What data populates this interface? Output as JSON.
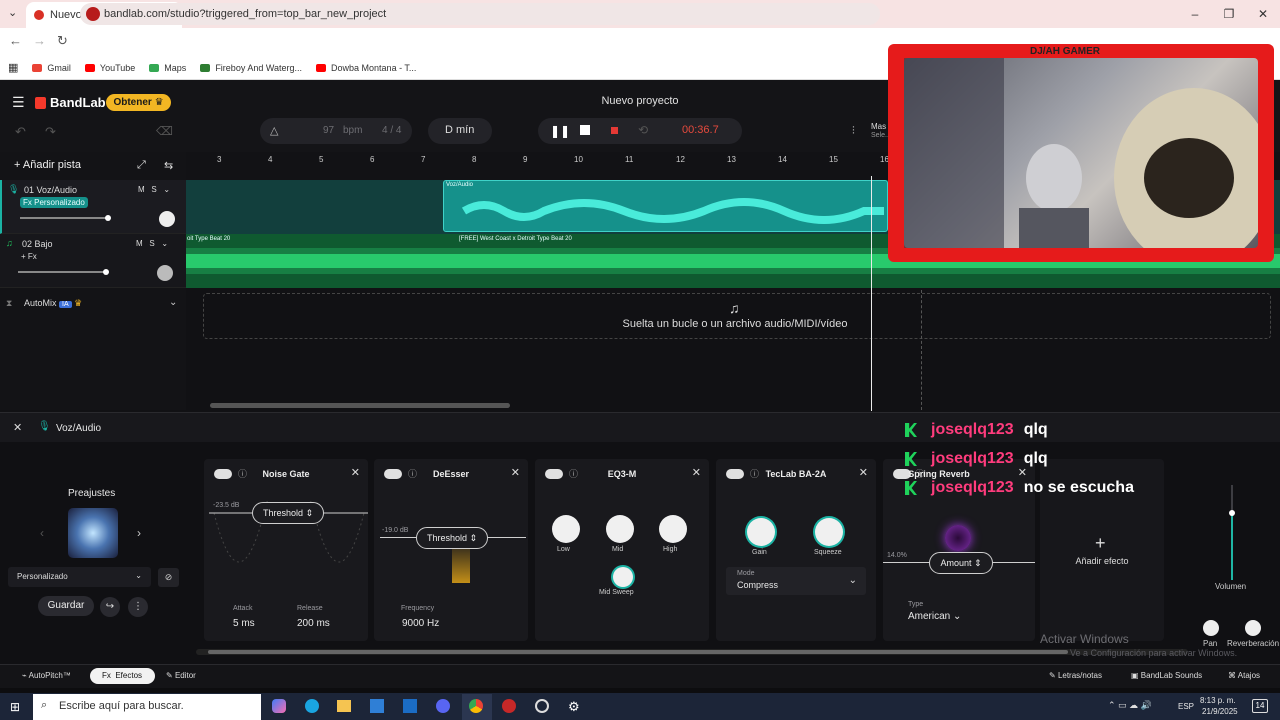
{
  "browser": {
    "tab_title": "Nuevo proyecto - Studio",
    "url": "bandlab.com/studio?triggered_from=top_bar_new_project",
    "bookmarks": [
      "Gmail",
      "YouTube",
      "Maps",
      "Fireboy And Waterg...",
      "Dowba Montana - T..."
    ]
  },
  "app": {
    "logo": "BandLab",
    "upgrade_label": "Obtener",
    "project_title": "Nuevo proyecto",
    "bpm_value": "97",
    "bpm_unit": "bpm",
    "time_signature": "4 / 4",
    "key": "D mín",
    "time": "00:36.7",
    "master_partial": "Mas",
    "master_partial2": "Sele..."
  },
  "tracks": {
    "add_label": "Añadir pista",
    "items": [
      {
        "name": "01  Voz/Audio",
        "fx": "Fx Personalizado",
        "clip": "Voz/Audio"
      },
      {
        "name": "02  Bajo",
        "fx": "+ Fx",
        "clip": "[FREE] West Coast x Detroit Type Beat 20",
        "clip_partial": "oit Type Beat 20"
      }
    ],
    "automix": "AutoMix",
    "automix_badge": "IA",
    "drop_text": "Suelta un bucle o un archivo audio/MIDI/vídeo",
    "ruler": [
      "3",
      "4",
      "5",
      "6",
      "7",
      "8",
      "9",
      "10",
      "11",
      "12",
      "13",
      "14",
      "15",
      "16"
    ]
  },
  "fx_panel": {
    "track_name": "Voz/Audio",
    "presets_title": "Preajustes",
    "preset_selected": "Personalizado",
    "save_label": "Guardar",
    "noise_gate": {
      "title": "Noise Gate",
      "db": "-23.5 dB",
      "threshold": "Threshold",
      "attack_label": "Attack",
      "attack": "5 ms",
      "release_label": "Release",
      "release": "200 ms"
    },
    "desser": {
      "title": "DeEsser",
      "db": "-19.0 dB",
      "threshold": "Threshold",
      "freq_label": "Frequency",
      "freq": "9000 Hz"
    },
    "eq": {
      "title": "EQ3-M",
      "low": "Low",
      "mid": "Mid",
      "high": "High",
      "sweep": "Mid Sweep"
    },
    "teclab": {
      "title": "TecLab BA-2A",
      "gain": "Gain",
      "squeeze": "Squeeze",
      "mode_label": "Mode",
      "mode": "Compress"
    },
    "spring": {
      "title": "Spring Reverb",
      "pct": "14.0%",
      "amount": "Amount",
      "type_label": "Type",
      "type": "American"
    },
    "add_effect": "Añadir efecto",
    "volume": "Volumen",
    "pan": "Pan",
    "reverb": "Reverberación"
  },
  "bottom": {
    "autopitch": "AutoPitch™",
    "effects": "Efectos",
    "editor": "Editor",
    "lyrics": "Letras/notas",
    "sounds": "BandLab Sounds",
    "shortcuts": "Atajos"
  },
  "chat": [
    {
      "user": "joseqlq123",
      "msg": "qlq"
    },
    {
      "user": "joseqlq123",
      "msg": "qlq"
    },
    {
      "user": "joseqlq123",
      "msg": "no se escucha"
    }
  ],
  "overlay": {
    "activate": "Activar Windows",
    "activate_sub": "Ve a Configuración para activar Windows.",
    "cam_title": "DJ/AH GAMER"
  },
  "taskbar": {
    "search_placeholder": "Escribe aquí para buscar.",
    "lang": "ESP",
    "time": "8:13 p. m.",
    "date": "21/9/2025",
    "notif": "14"
  },
  "colors": {
    "accent": "#f2b623",
    "brand": "#f5392b",
    "teal": "#15918b",
    "green": "#0f5a30",
    "chat_user": "#ff3c7d"
  }
}
